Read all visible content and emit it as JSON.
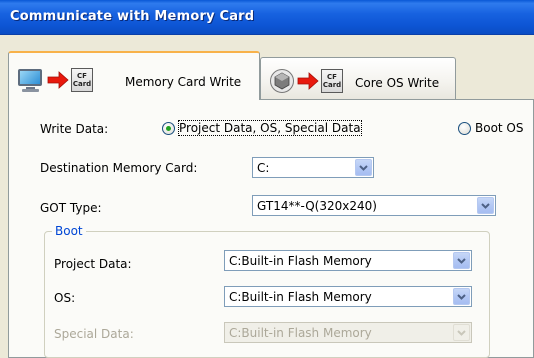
{
  "window": {
    "title": "Communicate with Memory Card"
  },
  "tabs": [
    {
      "label": "Memory Card Write",
      "cf_text": "CF\nCard",
      "active": true
    },
    {
      "label": "Core OS Write",
      "cf_text": "CF\nCard",
      "active": false
    }
  ],
  "icons": {
    "monitor": "monitor-icon",
    "arrow": "right-arrow-icon",
    "cf_card": "cf-card-icon",
    "chip": "core-chip-icon",
    "dropdown": "chevron-down-icon"
  },
  "form": {
    "write_data_label": "Write Data:",
    "write_data_options": [
      {
        "label": "Project Data, OS, Special Data",
        "selected": true
      },
      {
        "label": "Boot OS",
        "selected": false
      }
    ],
    "destination_label": "Destination Memory Card:",
    "destination_value": "C:",
    "got_type_label": "GOT Type:",
    "got_type_value": "GT14**-Q(320x240)",
    "boot_group_label": "Boot",
    "project_data_label": "Project Data:",
    "project_data_value": "C:Built-in Flash Memory",
    "os_label": "OS:",
    "os_value": "C:Built-in Flash Memory",
    "special_data_label": "Special Data:",
    "special_data_value": "C:Built-in Flash Memory"
  },
  "colors": {
    "title_bar": "#0a58d6",
    "active_tab_accent": "#f8b24a",
    "group_label": "#0046d5",
    "radio_selected": "#21a121",
    "disabled_text": "#aca899"
  }
}
